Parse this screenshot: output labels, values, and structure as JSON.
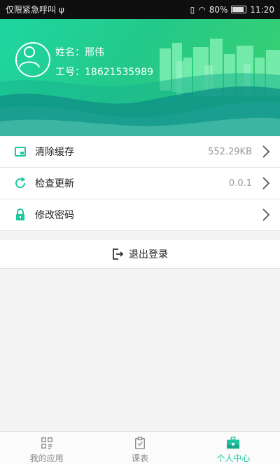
{
  "status_bar": {
    "left_text": "仅限紧急呼叫",
    "battery": "80%",
    "time": "11:20"
  },
  "profile": {
    "name_label": "姓名：邢伟",
    "id_label": "工号：18621535989"
  },
  "menu": {
    "items": [
      {
        "label": "清除缓存",
        "value": "552.29KB",
        "icon": "cache-icon"
      },
      {
        "label": "检查更新",
        "value": "0.0.1",
        "icon": "refresh-icon"
      },
      {
        "label": "修改密码",
        "value": "",
        "icon": "lock-icon"
      }
    ]
  },
  "logout": {
    "label": "退出登录",
    "icon": "logout-icon"
  },
  "tabbar": {
    "tabs": [
      {
        "label": "我的应用",
        "icon": "grid-icon"
      },
      {
        "label": "课表",
        "icon": "clipboard-check-icon"
      },
      {
        "label": "个人中心",
        "icon": "briefcase-icon"
      }
    ],
    "active_index": 2
  },
  "colors": {
    "accent": "#1ec6a0",
    "header_start": "#1fd6a0",
    "header_end": "#3bd06d"
  }
}
